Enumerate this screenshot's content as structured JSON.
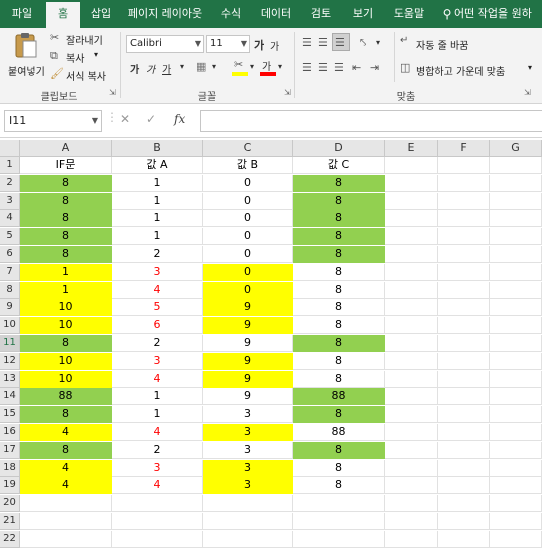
{
  "tabs": [
    "파일",
    "홈",
    "삽입",
    "페이지 레이아웃",
    "수식",
    "데이터",
    "검토",
    "보기",
    "도움말",
    "어떤 작업을 원하"
  ],
  "ribbon": {
    "paste_label": "붙여넣기",
    "cut_label": "잘라내기",
    "copy_label": "복사",
    "format_painter_label": "서식 복사",
    "clipboard_group": "클립보드",
    "font_name": "Calibri",
    "font_size": "11",
    "font_group": "글꼴",
    "wrap_text_label": "자동 줄 바꿈",
    "merge_center_label": "병합하고 가운데 맞춤",
    "alignment_group": "맞춤"
  },
  "formula_bar": {
    "name_box": "I11",
    "fx": "fx",
    "formula": ""
  },
  "columns": [
    "A",
    "B",
    "C",
    "D",
    "E",
    "F",
    "G"
  ],
  "colors": {
    "green": "#92d050",
    "yellow": "#ffff00",
    "red": "#ff0000",
    "black": "#000000",
    "ribbon_green": "#217346"
  },
  "selected_row": 11,
  "rows": [
    {
      "n": "1",
      "a": "IF문",
      "b": "값 A",
      "c": "값 B",
      "d": "값 C",
      "af": "",
      "bred": false,
      "cf": "",
      "df": ""
    },
    {
      "n": "2",
      "a": "8",
      "b": "1",
      "c": "0",
      "d": "8",
      "af": "green",
      "bred": false,
      "cf": "",
      "df": "green"
    },
    {
      "n": "3",
      "a": "8",
      "b": "1",
      "c": "0",
      "d": "8",
      "af": "green",
      "bred": false,
      "cf": "",
      "df": "green"
    },
    {
      "n": "4",
      "a": "8",
      "b": "1",
      "c": "0",
      "d": "8",
      "af": "green",
      "bred": false,
      "cf": "",
      "df": "green"
    },
    {
      "n": "5",
      "a": "8",
      "b": "1",
      "c": "0",
      "d": "8",
      "af": "green",
      "bred": false,
      "cf": "",
      "df": "green"
    },
    {
      "n": "6",
      "a": "8",
      "b": "2",
      "c": "0",
      "d": "8",
      "af": "green",
      "bred": false,
      "cf": "",
      "df": "green"
    },
    {
      "n": "7",
      "a": "1",
      "b": "3",
      "c": "0",
      "d": "8",
      "af": "yellow",
      "bred": true,
      "cf": "yellow",
      "df": ""
    },
    {
      "n": "8",
      "a": "1",
      "b": "4",
      "c": "0",
      "d": "8",
      "af": "yellow",
      "bred": true,
      "cf": "yellow",
      "df": ""
    },
    {
      "n": "9",
      "a": "10",
      "b": "5",
      "c": "9",
      "d": "8",
      "af": "yellow",
      "bred": true,
      "cf": "yellow",
      "df": ""
    },
    {
      "n": "10",
      "a": "10",
      "b": "6",
      "c": "9",
      "d": "8",
      "af": "yellow",
      "bred": true,
      "cf": "yellow",
      "df": ""
    },
    {
      "n": "11",
      "a": "8",
      "b": "2",
      "c": "9",
      "d": "8",
      "af": "green",
      "bred": false,
      "cf": "",
      "df": "green"
    },
    {
      "n": "12",
      "a": "10",
      "b": "3",
      "c": "9",
      "d": "8",
      "af": "yellow",
      "bred": true,
      "cf": "yellow",
      "df": ""
    },
    {
      "n": "13",
      "a": "10",
      "b": "4",
      "c": "9",
      "d": "8",
      "af": "yellow",
      "bred": true,
      "cf": "yellow",
      "df": ""
    },
    {
      "n": "14",
      "a": "88",
      "b": "1",
      "c": "9",
      "d": "88",
      "af": "green",
      "bred": false,
      "cf": "",
      "df": "green"
    },
    {
      "n": "15",
      "a": "8",
      "b": "1",
      "c": "3",
      "d": "8",
      "af": "green",
      "bred": false,
      "cf": "",
      "df": "green"
    },
    {
      "n": "16",
      "a": "4",
      "b": "4",
      "c": "3",
      "d": "88",
      "af": "yellow",
      "bred": true,
      "cf": "yellow",
      "df": ""
    },
    {
      "n": "17",
      "a": "8",
      "b": "2",
      "c": "3",
      "d": "8",
      "af": "green",
      "bred": false,
      "cf": "",
      "df": "green"
    },
    {
      "n": "18",
      "a": "4",
      "b": "3",
      "c": "3",
      "d": "8",
      "af": "yellow",
      "bred": true,
      "cf": "yellow",
      "df": ""
    },
    {
      "n": "19",
      "a": "4",
      "b": "4",
      "c": "3",
      "d": "8",
      "af": "yellow",
      "bred": true,
      "cf": "yellow",
      "df": ""
    },
    {
      "n": "20",
      "a": "",
      "b": "",
      "c": "",
      "d": "",
      "af": "",
      "bred": false,
      "cf": "",
      "df": ""
    },
    {
      "n": "21",
      "a": "",
      "b": "",
      "c": "",
      "d": "",
      "af": "",
      "bred": false,
      "cf": "",
      "df": ""
    },
    {
      "n": "22",
      "a": "",
      "b": "",
      "c": "",
      "d": "",
      "af": "",
      "bred": false,
      "cf": "",
      "df": ""
    }
  ]
}
